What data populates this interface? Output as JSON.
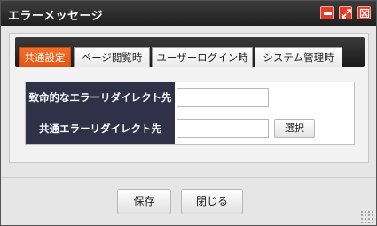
{
  "window": {
    "title": "エラーメッセージ",
    "controls": {
      "minimize_icon": "minimize-icon",
      "maximize_icon": "maximize-icon",
      "close_icon": "close-icon",
      "color": "#e53b2a"
    }
  },
  "tabs": [
    {
      "label": "共通設定",
      "active": true
    },
    {
      "label": "ページ閲覧時",
      "active": false
    },
    {
      "label": "ユーザーログイン時",
      "active": false
    },
    {
      "label": "システム管理時",
      "active": false
    }
  ],
  "form": {
    "rows": [
      {
        "label": "致命的なエラーリダイレクト先",
        "value": ""
      },
      {
        "label": "共通エラーリダイレクト先",
        "value": "",
        "button_label": "選択"
      }
    ]
  },
  "footer": {
    "save_label": "保存",
    "close_label": "閉じる"
  },
  "colors": {
    "active_tab": "#f26522",
    "label_cell": "#2e3147",
    "title_bar": "#2a2a2a"
  }
}
